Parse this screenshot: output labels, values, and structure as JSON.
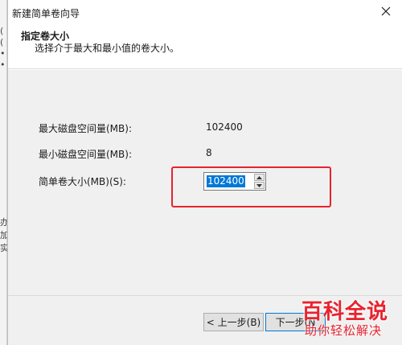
{
  "background_window": {
    "fragments": [
      "(",
      "(",
      "•",
      "•",
      "办",
      "加",
      "实"
    ]
  },
  "wizard": {
    "title": "新建简单卷向导",
    "header_title": "指定卷大小",
    "header_subtitle": "选择介于最大和最小值的卷大小。",
    "rows": [
      {
        "label": "最大磁盘空间量(MB):",
        "value": "102400"
      },
      {
        "label": "最小磁盘空间量(MB):",
        "value": "8"
      }
    ],
    "size_field": {
      "label": "简单卷大小(MB)(S):",
      "value": "102400"
    },
    "buttons": {
      "back": "< 上一步(B)",
      "next": "下一步(N"
    }
  },
  "watermark": {
    "main": "百科全说",
    "sub": "助你轻松解决"
  },
  "colors": {
    "highlight": "#e8232e",
    "selection": "#0078d7",
    "dialog_bg": "#f0f0f0"
  }
}
